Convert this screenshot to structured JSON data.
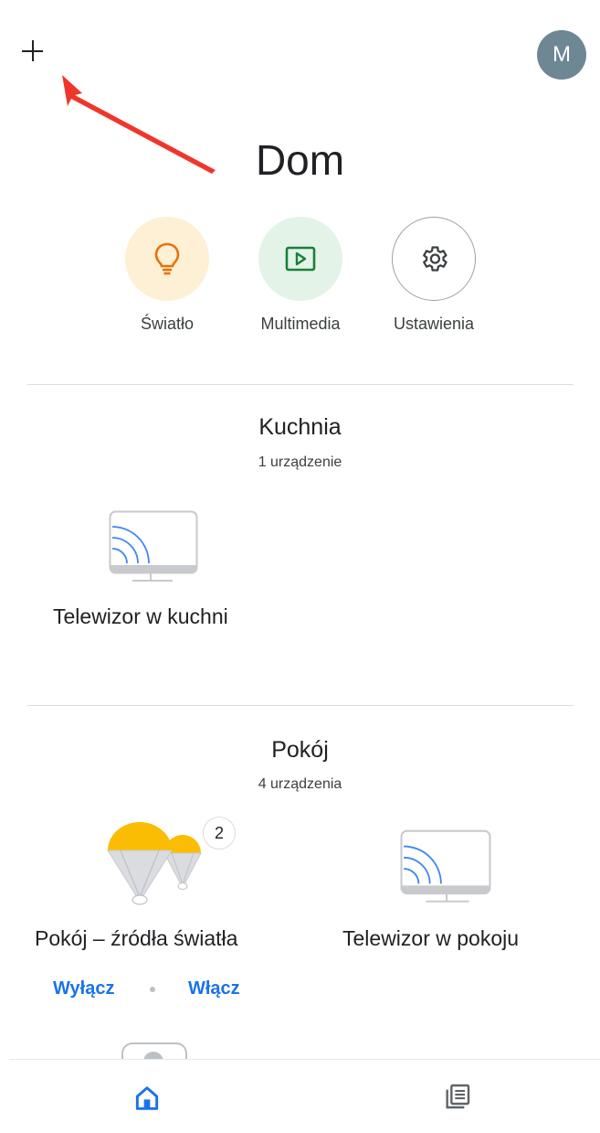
{
  "header": {
    "add_icon": "plus-icon",
    "avatar_initial": "M",
    "avatar_color": "#6e8795",
    "annotation_color": "#f0362b"
  },
  "home": {
    "title": "Dom"
  },
  "quick_actions": [
    {
      "label": "Światło",
      "icon": "lightbulb-icon",
      "color": "#e8710a"
    },
    {
      "label": "Multimedia",
      "icon": "play-icon",
      "color": "#188038"
    },
    {
      "label": "Ustawienia",
      "icon": "gear-icon",
      "color": "#3c4043"
    }
  ],
  "rooms": [
    {
      "name": "Kuchnia",
      "count": "1 urządzenie",
      "devices": [
        {
          "label": "Telewizor w kuchni",
          "icon": "tv-cast-icon"
        }
      ]
    },
    {
      "name": "Pokój",
      "count": "4 urządzenia",
      "devices": [
        {
          "label": "Pokój – źródła światła",
          "icon": "light-group-icon",
          "badge": "2",
          "actions": [
            "Wyłącz",
            "Włącz"
          ]
        },
        {
          "label": "Telewizor w pokoju",
          "icon": "tv-cast-icon"
        }
      ]
    }
  ],
  "bottom_nav": [
    {
      "name": "home",
      "icon": "home-icon",
      "active": true,
      "color": "#1a73e8"
    },
    {
      "name": "feed",
      "icon": "feed-icon",
      "active": false,
      "color": "#5f6368"
    }
  ]
}
